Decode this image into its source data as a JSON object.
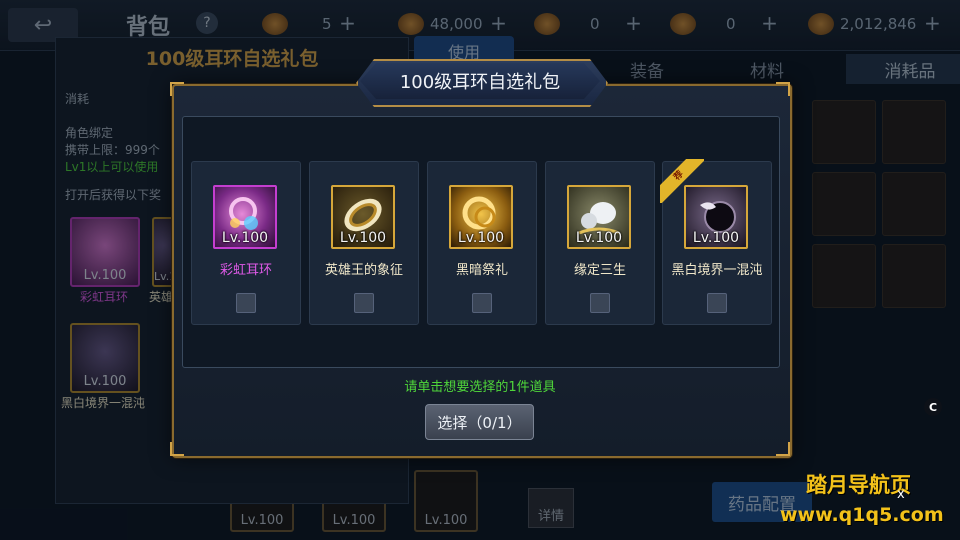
{
  "topbar": {
    "title": "背包",
    "help": "?",
    "resources": [
      {
        "value": "5",
        "plus": "+"
      },
      {
        "value": "48,000",
        "plus": "+"
      },
      {
        "value": "0",
        "plus": "+"
      },
      {
        "value": "0",
        "plus": "+"
      },
      {
        "value": "2,012,846",
        "plus": "+"
      }
    ]
  },
  "background": {
    "use_button": "使用",
    "tabs": [
      "装备",
      "材料",
      "消耗品"
    ],
    "detail_button": "详情",
    "medicine_button": "药品配置",
    "bottom_items": [
      "Lv.100",
      "Lv.100",
      "Lv.100"
    ]
  },
  "info_panel": {
    "title": "100级耳环自选礼包",
    "type": "消耗",
    "bind": "角色绑定",
    "carry_limit": "携带上限：999个",
    "level_req": "Lv1以上可以使用",
    "open_hint": "打开后获得以下奖",
    "items": [
      {
        "lv": "Lv.100",
        "name": "彩虹耳环"
      },
      {
        "lv": "Lv.100",
        "name": "英雄"
      },
      {
        "lv": "Lv.100",
        "name": "黑白境界一混沌"
      }
    ]
  },
  "modal": {
    "title": "100级耳环自选礼包",
    "options": [
      {
        "lv": "Lv.100",
        "name": "彩虹耳环",
        "rarity": "purple",
        "ribbon": ""
      },
      {
        "lv": "Lv.100",
        "name": "英雄王的象征",
        "rarity": "gold",
        "ribbon": ""
      },
      {
        "lv": "Lv.100",
        "name": "黑暗祭礼",
        "rarity": "gold",
        "ribbon": ""
      },
      {
        "lv": "Lv.100",
        "name": "缘定三生",
        "rarity": "gold",
        "ribbon": ""
      },
      {
        "lv": "Lv.100",
        "name": "黑白境界一混沌",
        "rarity": "gold",
        "ribbon": "荐"
      }
    ],
    "hint": "请单击想要选择的1件道具",
    "select_button": "选择（0/1）"
  },
  "overlay": {
    "c_badge": "C",
    "watermark_line1": "踏月导航页",
    "watermark_line2": "www.q1q5.com",
    "watermark_close": "x"
  },
  "colors": {
    "accent_gold": "#d6a73a",
    "purple_rarity": "#c43ed0",
    "hint_green": "#4fd63a",
    "watermark_yellow": "#f3c21a"
  }
}
